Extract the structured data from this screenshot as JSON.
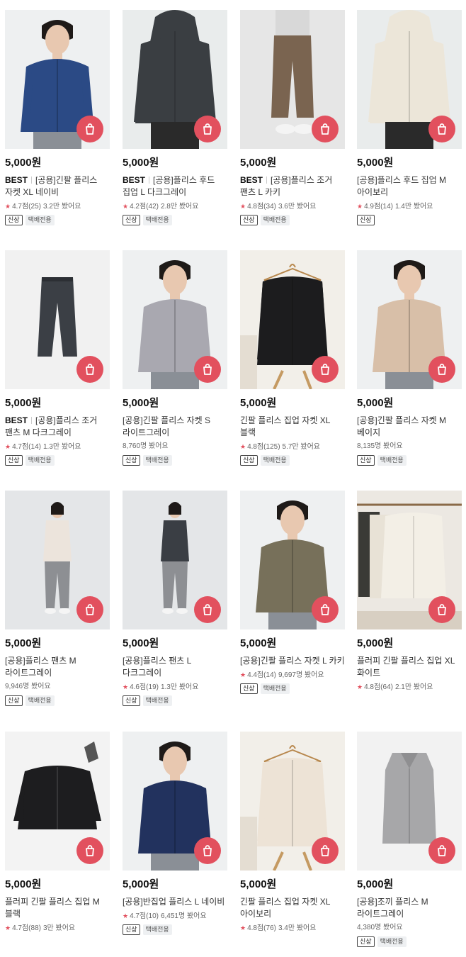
{
  "products": [
    {
      "price": "5,000원",
      "best": "BEST",
      "title": "[공용]긴팔 플리스 자켓 XL 네이비",
      "rating": "4.7점(25)",
      "views": "3.2만 봤어요",
      "tags": [
        "신상",
        "택배전용"
      ],
      "art": "jacket",
      "color": "#2b4a85",
      "bg": "#eef0f1",
      "image": "model"
    },
    {
      "price": "5,000원",
      "best": "BEST",
      "title": "[공용]플리스 후드 집업 L 다크그레이",
      "rating": "4.2점(42)",
      "views": "2.8만 봤어요",
      "tags": [
        "신상",
        "택배전용"
      ],
      "art": "hoodie",
      "color": "#3a3e42",
      "bg": "#e9ecec",
      "image": "torso"
    },
    {
      "price": "5,000원",
      "best": "BEST",
      "title": "[공용]플리스 조거 팬츠 L 카키",
      "rating": "4.8점(34)",
      "views": "3.6만 봤어요",
      "tags": [
        "신상",
        "택배전용"
      ],
      "art": "pants",
      "color": "#7a6450",
      "bg": "#e6e6e6",
      "image": "legs"
    },
    {
      "price": "5,000원",
      "best": "",
      "title": "[공용]플리스 후드 집업 M 아이보리",
      "rating": "4.9점(14)",
      "views": "1.4만 봤어요",
      "tags": [
        "신상"
      ],
      "art": "hoodie",
      "color": "#ece6d9",
      "bg": "#eeeeee",
      "image": "torso"
    },
    {
      "price": "5,000원",
      "best": "BEST",
      "title": "[공용]플리스 조거 팬츠 M 다크그레이",
      "rating": "4.7점(14)",
      "views": "1.3만 봤어요",
      "tags": [
        "신상",
        "택배전용"
      ],
      "art": "flatpants",
      "color": "#3b3f45",
      "bg": "#f1f1f1",
      "image": "flat"
    },
    {
      "price": "5,000원",
      "best": "",
      "title": "[공용]긴팔 플리스 자켓 S 라이트그레이",
      "rating": "",
      "views": "8,760명 봤어요",
      "tags": [
        "신상",
        "택배전용"
      ],
      "art": "jacket",
      "color": "#a9a8b0",
      "bg": "#eef0f1",
      "image": "model"
    },
    {
      "price": "5,000원",
      "best": "",
      "title": "긴팔 플리스 집업 자켓 XL 블랙",
      "rating": "4.8점(125)",
      "views": "5.7만 봤어요",
      "tags": [
        "신상",
        "택배전용"
      ],
      "art": "hanger",
      "color": "#1c1c1e",
      "bg": "#f2efe9",
      "image": "hanger"
    },
    {
      "price": "5,000원",
      "best": "",
      "title": "[공용]긴팔 플리스 자켓 M 베이지",
      "rating": "",
      "views": "8,135명 봤어요",
      "tags": [
        "신상",
        "택배전용"
      ],
      "art": "jacket",
      "color": "#d8bfa8",
      "bg": "#eef0f1",
      "image": "model"
    },
    {
      "price": "5,000원",
      "best": "",
      "title": "[공용]플리스 팬츠 M 라이트그레이",
      "rating": "",
      "views": "9,946명 봤어요",
      "tags": [
        "신상",
        "택배전용"
      ],
      "art": "full",
      "color": "#ece4dc",
      "bg": "#e4e6e8",
      "image": "full"
    },
    {
      "price": "5,000원",
      "best": "",
      "title": "[공용]플리스 팬츠 L 다크그레이",
      "rating": "4.6점(19)",
      "views": "1.3만 봤어요",
      "tags": [
        "신상",
        "택배전용"
      ],
      "art": "full",
      "color": "#3a3e44",
      "bg": "#e8eaec",
      "image": "full"
    },
    {
      "price": "5,000원",
      "best": "",
      "title": "[공용]긴팔 플리스 자켓 L 카키",
      "rating": "4.4점(14)",
      "views": "9,697명 봤어요",
      "tags": [
        "신상",
        "택배전용"
      ],
      "art": "jacket",
      "color": "#77705a",
      "bg": "#eef0f1",
      "image": "model"
    },
    {
      "price": "5,000원",
      "best": "",
      "title": "플러피 긴팔 플리스 집업 XL 화이트",
      "rating": "4.8점(64)",
      "views": "2.1만 봤어요",
      "tags": [],
      "art": "rack",
      "color": "#f3efe6",
      "bg": "#ece8e2",
      "image": "rack"
    },
    {
      "price": "5,000원",
      "best": "",
      "title": "플러피 긴팔 플리스 집업 M 블랙",
      "rating": "4.7점(88)",
      "views": "3만 봤어요",
      "tags": [],
      "art": "flatjacket",
      "color": "#1d1d1f",
      "bg": "#f3f3f3",
      "image": "flat"
    },
    {
      "price": "5,000원",
      "best": "",
      "title": "[공용]반집업 플리스 L 네이비",
      "rating": "4.7점(10)",
      "views": "6,451명 봤어요",
      "tags": [
        "신상",
        "택배전용"
      ],
      "art": "jacket",
      "color": "#22325e",
      "bg": "#eef0f1",
      "image": "model"
    },
    {
      "price": "5,000원",
      "best": "",
      "title": "긴팔 플리스 집업 자켓 XL 아이보리",
      "rating": "4.8점(76)",
      "views": "3.4만 봤어요",
      "tags": [],
      "art": "hanger",
      "color": "#ede3d6",
      "bg": "#f2efe9",
      "image": "hanger"
    },
    {
      "price": "5,000원",
      "best": "",
      "title": "[공용]조끼 플리스 M 라이트그레이",
      "rating": "",
      "views": "4,380명 봤어요",
      "tags": [
        "신상",
        "택배전용"
      ],
      "art": "vest",
      "color": "#a7a7a9",
      "bg": "#f2f2f2",
      "image": "flat"
    }
  ],
  "icons": {
    "cart": "shopping-bag-icon",
    "star": "★"
  },
  "colors": {
    "accent": "#e2505e"
  }
}
